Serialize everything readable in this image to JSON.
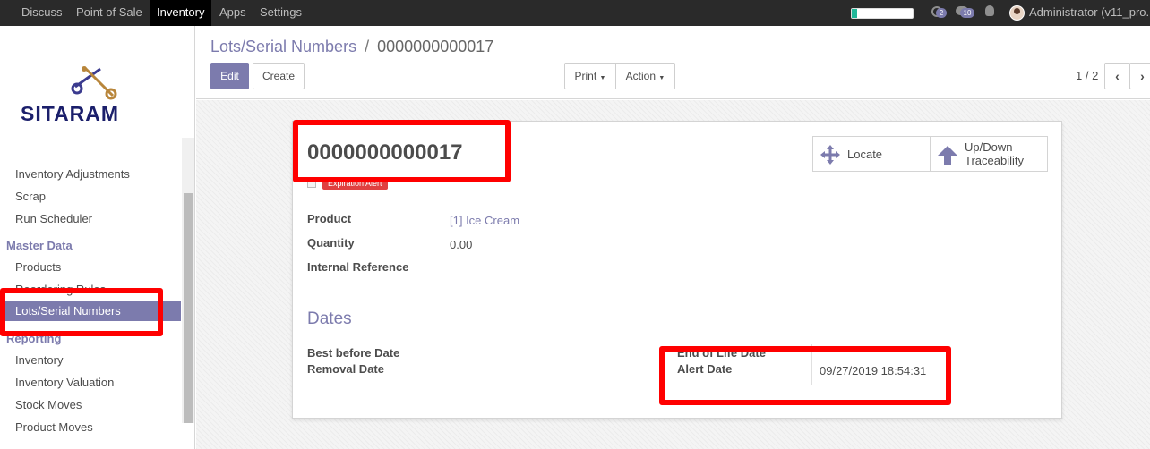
{
  "topbar": {
    "menu": [
      "Discuss",
      "Point of Sale",
      "Inventory",
      "Apps",
      "Settings"
    ],
    "chat_count": "2",
    "activity_count": "10",
    "user": "Administrator (v11_pro..."
  },
  "sidebar": {
    "brand": "SITARAM",
    "items_top": [
      "Inventory Adjustments",
      "Scrap",
      "Run Scheduler"
    ],
    "master_header": "Master Data",
    "master_items": [
      "Products",
      "Reordering Rules"
    ],
    "active_item": "Lots/Serial Numbers",
    "reporting_header": "Reporting",
    "reporting_items": [
      "Inventory",
      "Inventory Valuation",
      "Stock Moves",
      "Product Moves"
    ]
  },
  "control": {
    "breadcrumb_parent": "Lots/Serial Numbers",
    "breadcrumb_sep": "/",
    "breadcrumb_current": "0000000000017",
    "edit": "Edit",
    "create": "Create",
    "print": "Print",
    "action": "Action",
    "pager": "1 / 2"
  },
  "form": {
    "title": "0000000000017",
    "badge": "Expiration Alert",
    "locate": "Locate",
    "traceability_1": "Up/Down",
    "traceability_2": "Traceability",
    "product_label": "Product",
    "product_value": "[1] Ice Cream",
    "quantity_label": "Quantity",
    "quantity_value": "0.00",
    "ref_label": "Internal Reference",
    "dates_header": "Dates",
    "best_before_label": "Best before Date",
    "removal_label": "Removal Date",
    "end_of_life_label": "End of Life Date",
    "alert_label": "Alert Date",
    "alert_value": "09/27/2019 18:54:31"
  },
  "colors": {
    "accent": "#7c7bad",
    "highlight": "#ff0000",
    "badge": "#e04040"
  }
}
